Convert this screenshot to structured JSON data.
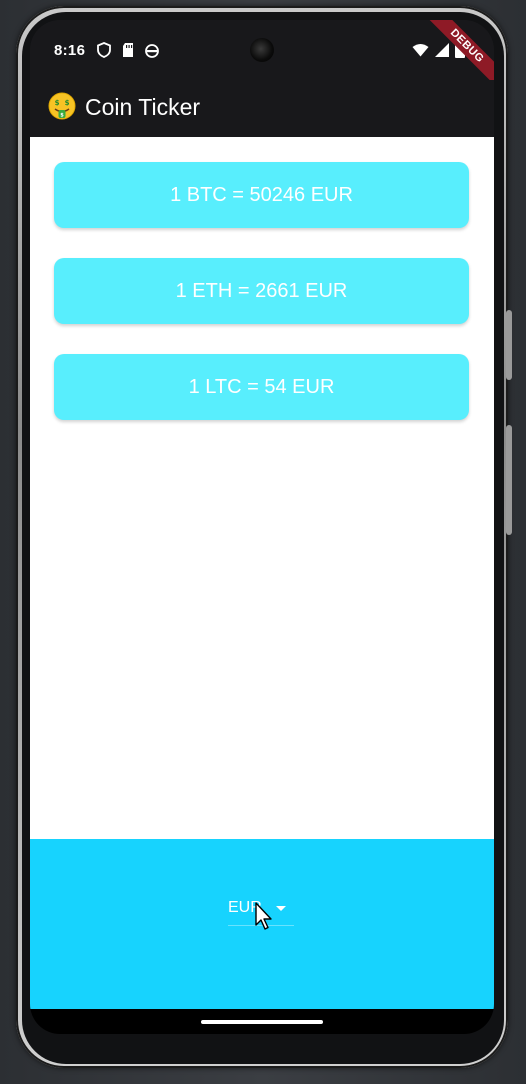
{
  "status_bar": {
    "time": "8:16",
    "left_icons": [
      "shield-icon",
      "sd-card-icon",
      "android-icon"
    ],
    "right_icons": [
      "wifi-icon",
      "signal-icon",
      "battery-icon"
    ],
    "debug_label": "DEBUG"
  },
  "app_bar": {
    "emoji_icon": "money-mouth-face-icon",
    "title": "Coin Ticker"
  },
  "rates": [
    {
      "text": "1 BTC = 50246 EUR"
    },
    {
      "text": "1 ETH = 2661 EUR"
    },
    {
      "text": "1 LTC = 54 EUR"
    }
  ],
  "currency_picker": {
    "selected": "EUR"
  },
  "colors": {
    "card": "#58eefd",
    "bottom_panel": "#17d3fe",
    "app_bar": "#18181b",
    "debug_ribbon": "#8e1a26"
  }
}
